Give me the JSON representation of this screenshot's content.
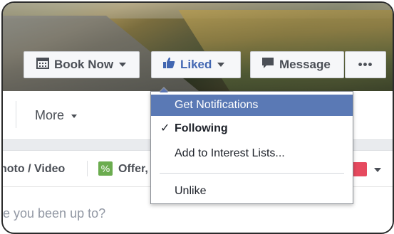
{
  "header": {
    "book_now_label": "Book Now",
    "liked_label": "Liked",
    "message_label": "Message",
    "more_options_label": "•••"
  },
  "nav": {
    "more_label": "More"
  },
  "composer": {
    "photo_video_label": "hoto / Video",
    "offer_label": "Offer,",
    "placeholder": "re you been up to?"
  },
  "liked_menu": {
    "items": [
      {
        "label": "Get Notifications",
        "highlighted": true
      },
      {
        "label": "Following",
        "checked": true
      },
      {
        "label": "Add to Interest Lists..."
      },
      {
        "label": "Unlike"
      }
    ]
  },
  "colors": {
    "accent": "#4267b2",
    "menu_highlight": "#5a79b5",
    "offer_icon": "#6bac4f",
    "red_icon": "#e64a5f"
  },
  "icons": [
    "calendar-icon",
    "thumbs-up-icon",
    "message-icon",
    "ellipsis-icon",
    "checkmark-icon",
    "offer-icon",
    "caret-down-icon"
  ]
}
